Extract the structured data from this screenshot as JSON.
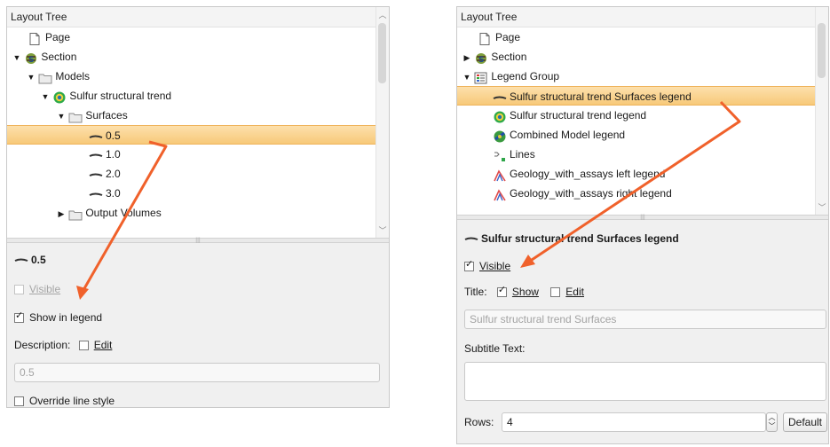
{
  "left": {
    "title": "Layout Tree",
    "items": [
      {
        "label": "Page"
      },
      {
        "label": "Section"
      },
      {
        "label": "Models"
      },
      {
        "label": "Sulfur structural trend"
      },
      {
        "label": "Surfaces"
      },
      {
        "label": "0.5"
      },
      {
        "label": "1.0"
      },
      {
        "label": "2.0"
      },
      {
        "label": "3.0"
      },
      {
        "label": "Output Volumes"
      }
    ],
    "props": {
      "heading": "0.5",
      "visible": "Visible",
      "show_in_legend": "Show in legend",
      "description": "Description:",
      "edit": "Edit",
      "desc_value": "0.5",
      "override": "Override line style"
    }
  },
  "right": {
    "title": "Layout Tree",
    "items": [
      {
        "label": "Page"
      },
      {
        "label": "Section"
      },
      {
        "label": "Legend Group"
      },
      {
        "label": "Sulfur structural trend Surfaces legend"
      },
      {
        "label": "Sulfur structural trend legend"
      },
      {
        "label": "Combined Model legend"
      },
      {
        "label": "Lines"
      },
      {
        "label": "Geology_with_assays left legend"
      },
      {
        "label": "Geology_with_assays right legend"
      }
    ],
    "props": {
      "heading": "Sulfur structural trend Surfaces legend",
      "visible": "Visible",
      "title": "Title:",
      "show": "Show",
      "edit": "Edit",
      "title_value": "Sulfur structural trend Surfaces",
      "subtitle": "Subtitle Text:",
      "rows": "Rows:",
      "rows_value": "4",
      "default": "Default"
    }
  },
  "colors": {
    "selection": "#f7c979",
    "arrow": "#f0612b"
  }
}
